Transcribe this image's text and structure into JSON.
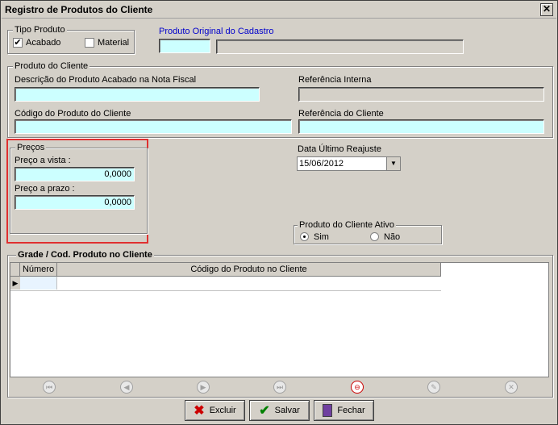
{
  "window": {
    "title": "Registro de Produtos do Cliente",
    "close_glyph": "✕"
  },
  "tipo_produto": {
    "legend": "Tipo Produto",
    "acabado_label": "Acabado",
    "acabado_checked": true,
    "material_label": "Material",
    "material_checked": false
  },
  "produto_original": {
    "label": "Produto Original do Cadastro",
    "code_value": "",
    "desc_value": ""
  },
  "produto_cliente": {
    "legend": "Produto do Cliente",
    "descricao_label": "Descrição do Produto Acabado na Nota Fiscal",
    "descricao_value": "",
    "ref_interna_label": "Referência Interna",
    "ref_interna_value": "",
    "codigo_label": "Código do Produto do Cliente",
    "codigo_value": "",
    "ref_cliente_label": "Referência do Cliente",
    "ref_cliente_value": ""
  },
  "precos": {
    "legend": "Preços",
    "vista_label": "Preço a vista :",
    "vista_value": "0,0000",
    "prazo_label": "Preço a prazo :",
    "prazo_value": "0,0000"
  },
  "reajuste": {
    "label": "Data Último Reajuste",
    "value": "15/06/2012"
  },
  "ativo": {
    "legend": "Produto do Cliente Ativo",
    "sim_label": "Sim",
    "nao_label": "Não",
    "selected": "Sim"
  },
  "grade": {
    "legend": "Grade / Cod. Produto no Cliente",
    "columns": [
      "Número",
      "Código do Produto no Cliente"
    ],
    "rows": [
      {
        "numero": "",
        "codigo": ""
      }
    ]
  },
  "nav_icons": [
    "first-icon",
    "prior-icon",
    "next-icon",
    "last-icon",
    "insert-icon",
    "edit-icon",
    "cancel-icon"
  ],
  "buttons": {
    "excluir": "Excluir",
    "salvar": "Salvar",
    "fechar": "Fechar"
  },
  "colors": {
    "input_bg": "#ccffff",
    "highlight_border": "#e03030",
    "link_blue": "#0000cc"
  }
}
